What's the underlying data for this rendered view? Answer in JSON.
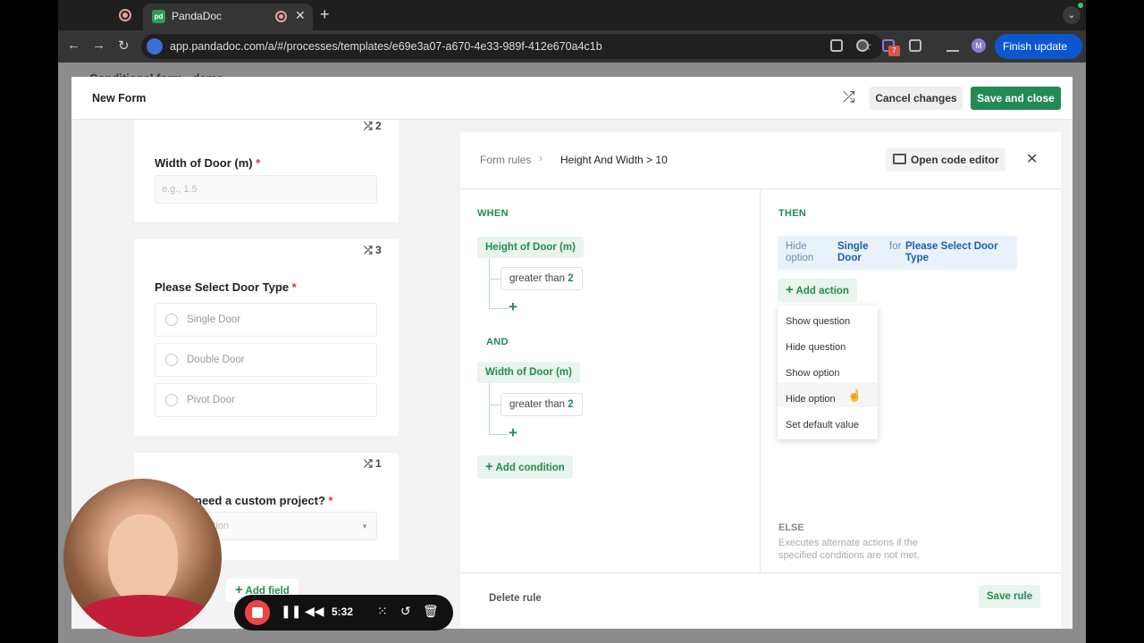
{
  "browser": {
    "tab_title": "PandaDoc",
    "tab_favicon": "pd",
    "url": "app.pandadoc.com/a/#/processes/templates/e69e3a07-a670-4e33-989f-412e670a4c1b",
    "ext_badge": "7",
    "profile_initial": "M",
    "finish_update_label": "Finish update",
    "icons": [
      "record-icon",
      "close-icon",
      "plus-icon",
      "back-icon",
      "forward-icon",
      "reload-icon",
      "star-icon",
      "menu-dots-icon"
    ]
  },
  "background_title": "Conditional form - demo",
  "modal": {
    "title": "New Form",
    "cancel_label": "Cancel changes",
    "save_label": "Save and close"
  },
  "cards": {
    "width": {
      "badge": "2",
      "label": "Width of Door (m)",
      "required": "*",
      "placeholder": "e.g., 1.5"
    },
    "door_type": {
      "badge": "3",
      "label": "Please Select Door Type",
      "required": "*",
      "options": [
        "Single Door",
        "Double Door",
        "Pivot Door"
      ]
    },
    "custom": {
      "badge": "1",
      "label": "need a custom project?",
      "required": "*",
      "placeholder": "option"
    },
    "add_field_label": "Add field"
  },
  "rule": {
    "breadcrumb_root": "Form rules",
    "breadcrumb_current": "Height And Width > 10",
    "code_editor_label": "Open code editor",
    "when_label": "WHEN",
    "and_label": "AND",
    "conditions": [
      {
        "field": "Height of Door (m)",
        "operator": "greater than",
        "value": "2"
      },
      {
        "field": "Width of Door (m)",
        "operator": "greater than",
        "value": "2"
      }
    ],
    "add_condition_label": "Add condition",
    "then_label": "THEN",
    "action": {
      "verb": "Hide option",
      "option": "Single Door",
      "for": "for",
      "target": "Please Select Door Type"
    },
    "add_action_label": "Add action",
    "action_menu": [
      "Show question",
      "Hide question",
      "Show option",
      "Hide option",
      "Set default value"
    ],
    "else_label": "ELSE",
    "else_desc": "Executes alternate actions if the specified conditions are not met.",
    "delete_label": "Delete rule",
    "save_rule_label": "Save rule"
  },
  "recorder": {
    "time": "5:32"
  },
  "colors": {
    "brand_green": "#248a55",
    "required_red": "#d43c3c",
    "action_blue": "#1f5fa8"
  }
}
